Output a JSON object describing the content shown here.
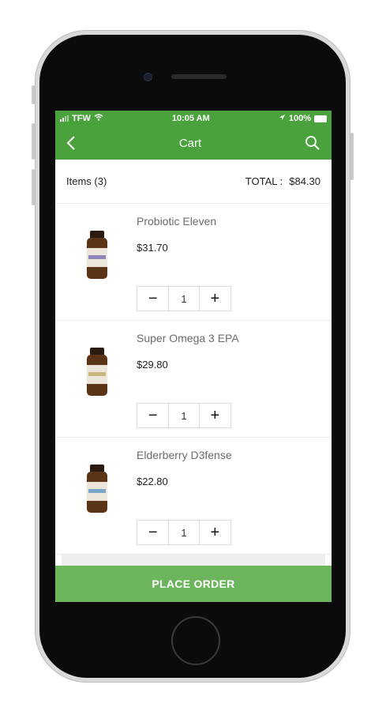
{
  "status_bar": {
    "carrier": "TFW",
    "time": "10:05 AM",
    "battery": "100%"
  },
  "header": {
    "title": "Cart"
  },
  "summary": {
    "items_label": "Items (3)",
    "total_label": "TOTAL :",
    "total_value": "$84.30"
  },
  "items": [
    {
      "name": "Probiotic Eleven",
      "price": "$31.70",
      "quantity": "1"
    },
    {
      "name": "Super Omega 3 EPA",
      "price": "$29.80",
      "quantity": "1"
    },
    {
      "name": "Elderberry D3fense",
      "price": "$22.80",
      "quantity": "1"
    }
  ],
  "stepper": {
    "minus": "−",
    "plus": "+"
  },
  "footer": {
    "place_order_label": "PLACE ORDER"
  },
  "colors": {
    "header_green": "#49a23b",
    "button_green": "#6cb55d"
  },
  "icons": [
    "signal-icon",
    "wifi-icon",
    "location-arrow-icon",
    "battery-icon",
    "back-chevron-icon",
    "search-icon",
    "product-bottle-icon"
  ]
}
